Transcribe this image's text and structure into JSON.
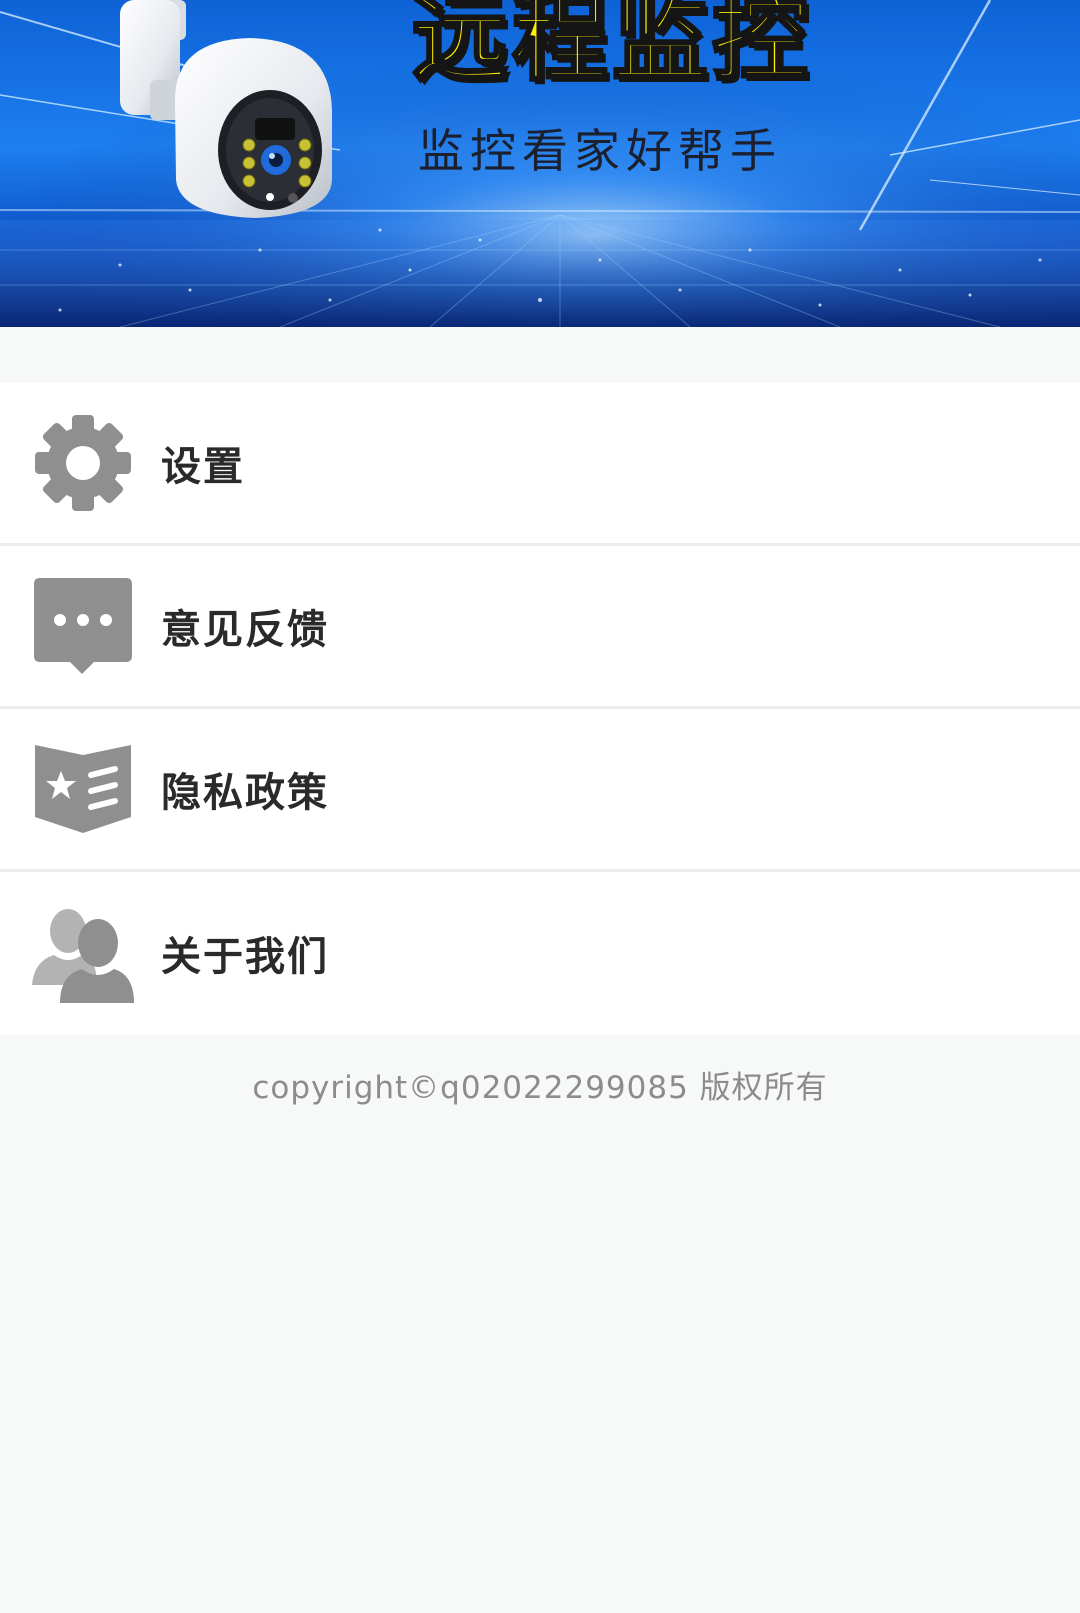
{
  "banner": {
    "title": "远程监控",
    "subtitle": "监控看家好帮手",
    "colors": {
      "title": "#fff200",
      "background": "#1d7ff0"
    }
  },
  "menu": {
    "items": [
      {
        "label": "设置",
        "icon": "gear-icon"
      },
      {
        "label": "意见反馈",
        "icon": "chat-bubble-icon"
      },
      {
        "label": "隐私政策",
        "icon": "privacy-book-icon"
      },
      {
        "label": "关于我们",
        "icon": "users-icon"
      }
    ],
    "icon_color": "#8f8f8f"
  },
  "footer": {
    "copyright": "copyright©q02022299085 版权所有"
  }
}
